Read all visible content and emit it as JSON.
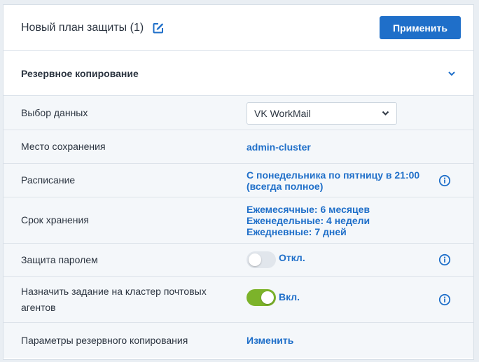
{
  "plan": {
    "title": "Новый план защиты (1)"
  },
  "toolbar": {
    "apply_label": "Применить"
  },
  "section": {
    "title": "Резервное копирование"
  },
  "rows": {
    "data_select": {
      "label": "Выбор данных",
      "value": "VK WorkMail"
    },
    "location": {
      "label": "Место сохранения",
      "value": "admin-cluster"
    },
    "schedule": {
      "label": "Расписание",
      "line1": "С понедельника по пятницу в 21:00",
      "line2": "(всегда полное)"
    },
    "retention": {
      "label": "Срок хранения",
      "line1": "Ежемесячные: 6 месяцев",
      "line2": "Еженедельные: 4 недели",
      "line3": "Ежедневные: 7 дней"
    },
    "password": {
      "label": "Защита паролем",
      "state": "Откл.",
      "enabled": false
    },
    "cluster": {
      "label_line1": "Назначить задание на кластер почтовых",
      "label_line2": "агентов",
      "state": "Вкл.",
      "enabled": true
    },
    "backup_params": {
      "label": "Параметры резервного копирования",
      "value": "Изменить"
    }
  },
  "icons": {
    "edit": "edit-icon",
    "chevron": "chevron-down-icon",
    "info": "info-icon"
  },
  "colors": {
    "accent": "#1f6fc9",
    "toggle_on": "#7cb32a",
    "toggle_off": "#e1e6ec"
  }
}
